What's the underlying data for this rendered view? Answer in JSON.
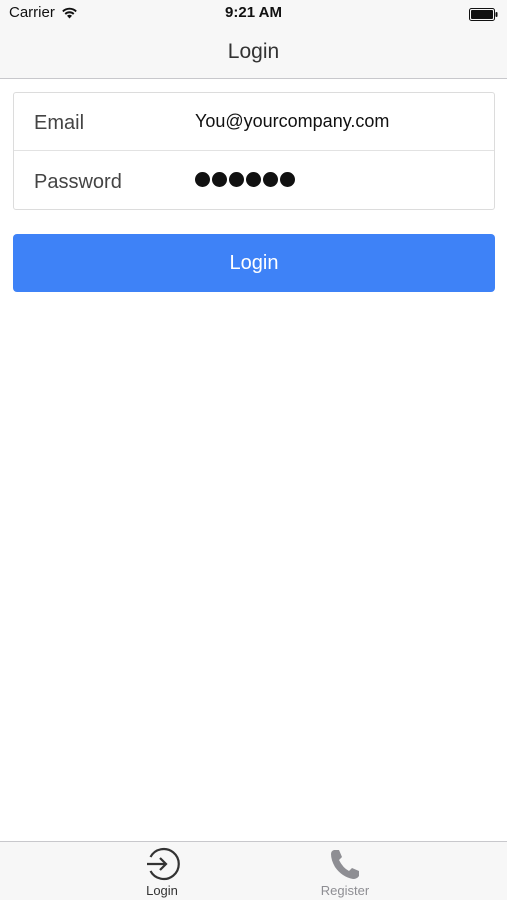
{
  "status_bar": {
    "carrier": "Carrier",
    "time": "9:21 AM",
    "wifi_icon": "wifi-icon",
    "battery_icon": "battery-icon"
  },
  "nav": {
    "title": "Login"
  },
  "form": {
    "email": {
      "label": "Email",
      "value": "You@yourcompany.com"
    },
    "password": {
      "label": "Password",
      "masked_length": 6
    }
  },
  "login_button": {
    "label": "Login",
    "color": "#3e82f7"
  },
  "tab_bar": {
    "tabs": [
      {
        "label": "Login",
        "icon": "login-arrow-icon",
        "active": true
      },
      {
        "label": "Register",
        "icon": "phone-icon",
        "active": false
      }
    ]
  }
}
